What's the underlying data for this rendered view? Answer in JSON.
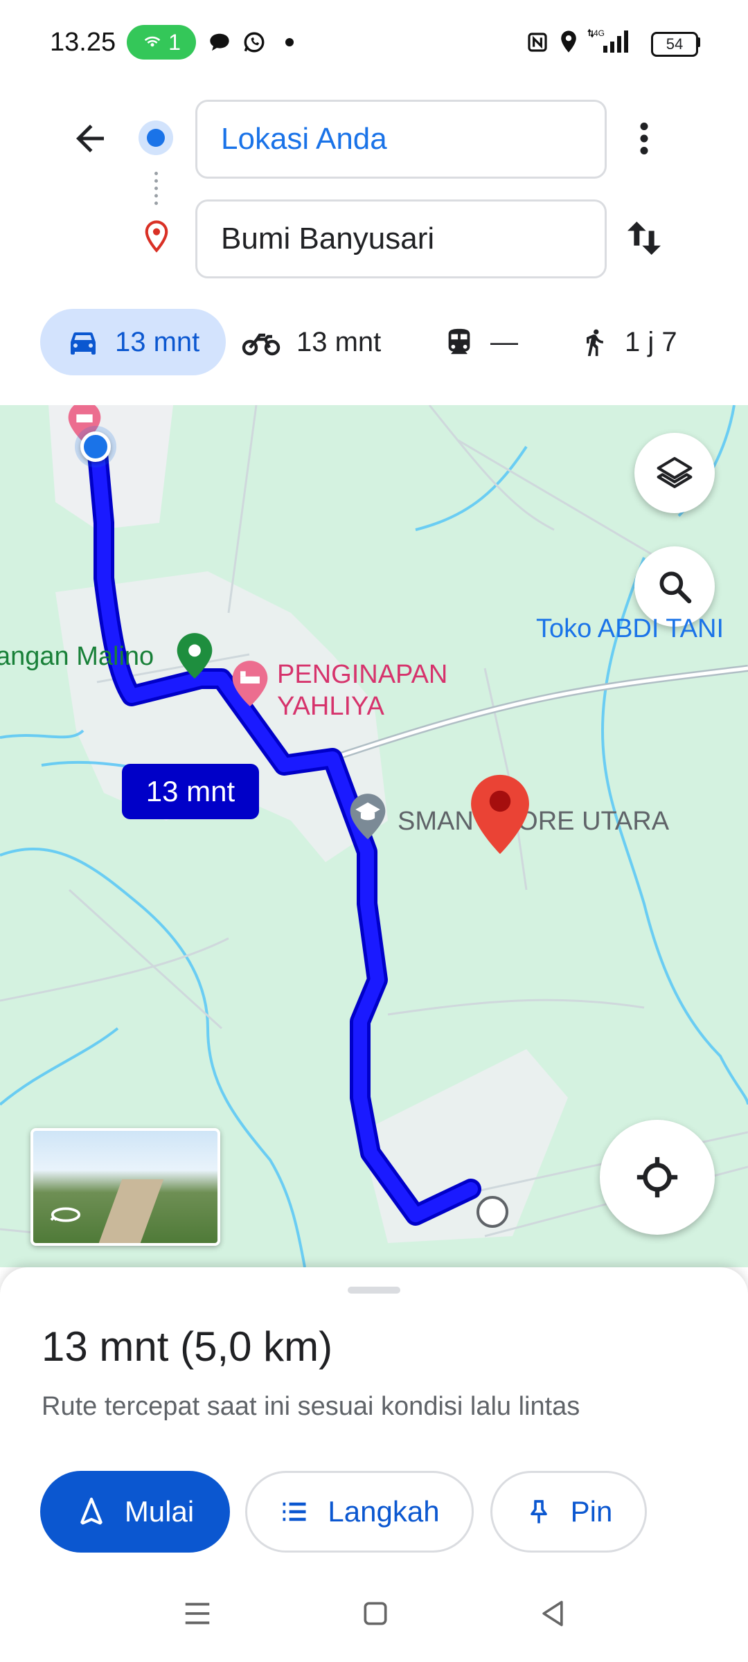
{
  "status_bar": {
    "time": "13.25",
    "hotspot_count": "1",
    "battery": "54"
  },
  "directions": {
    "origin": "Lokasi Anda",
    "destination": "Bumi Banyusari"
  },
  "modes": [
    {
      "name": "car",
      "label": "13 mnt",
      "active": true
    },
    {
      "name": "motorcycle",
      "label": "13 mnt"
    },
    {
      "name": "transit",
      "label": "—"
    },
    {
      "name": "walk",
      "label": "1 j 7"
    }
  ],
  "map": {
    "labels": {
      "toko": "Toko ABDI TANI",
      "lapangan": "angan Malino",
      "penginapan_line1": "PENGINAPAN",
      "penginapan_line2": "YAHLIYA",
      "sman": "SMAN 1 LORE UTARA"
    },
    "route_time_badge": "13 mnt",
    "route_color": "#1a1aff",
    "destination_pin_color": "#ea4335"
  },
  "summary": {
    "time_distance": "13 mnt (5,0 km)",
    "note": "Rute tercepat saat ini sesuai kondisi lalu lintas"
  },
  "actions": {
    "start": "Mulai",
    "steps": "Langkah",
    "pin": "Pin"
  }
}
